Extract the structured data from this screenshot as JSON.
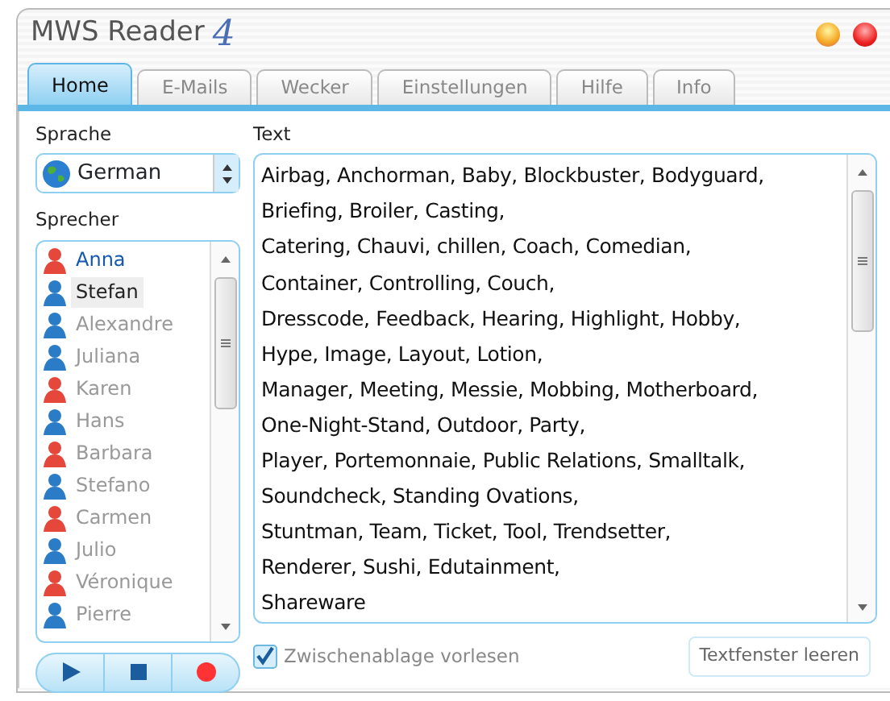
{
  "window": {
    "title": "MWS Reader",
    "version": "4"
  },
  "tabs": [
    {
      "label": "Home",
      "selected": true
    },
    {
      "label": "E-Mails",
      "selected": false
    },
    {
      "label": "Wecker",
      "selected": false
    },
    {
      "label": "Einstellungen",
      "selected": false
    },
    {
      "label": "Hilfe",
      "selected": false
    },
    {
      "label": "Info",
      "selected": false
    }
  ],
  "language": {
    "label": "Sprache",
    "value": "German"
  },
  "speakers": {
    "label": "Sprecher",
    "items": [
      {
        "name": "Anna",
        "kind": "female",
        "selected": false,
        "active": true
      },
      {
        "name": "Stefan",
        "kind": "male",
        "selected": true,
        "active": false
      },
      {
        "name": "Alexandre",
        "kind": "male",
        "selected": false,
        "active": false
      },
      {
        "name": "Juliana",
        "kind": "male",
        "selected": false,
        "active": false
      },
      {
        "name": "Karen",
        "kind": "female",
        "selected": false,
        "active": false
      },
      {
        "name": "Hans",
        "kind": "male",
        "selected": false,
        "active": false
      },
      {
        "name": "Barbara",
        "kind": "female",
        "selected": false,
        "active": false
      },
      {
        "name": "Stefano",
        "kind": "male",
        "selected": false,
        "active": false
      },
      {
        "name": "Carmen",
        "kind": "female",
        "selected": false,
        "active": false
      },
      {
        "name": "Julio",
        "kind": "male",
        "selected": false,
        "active": false
      },
      {
        "name": "Véronique",
        "kind": "female",
        "selected": false,
        "active": false
      },
      {
        "name": "Pierre",
        "kind": "male",
        "selected": false,
        "active": false
      }
    ]
  },
  "text": {
    "label": "Text",
    "lines": [
      "Airbag, Anchorman, Baby, Blockbuster, Bodyguard,",
      "Briefing, Broiler, Casting,",
      "Catering, Chauvi, chillen, Coach, Comedian,",
      "Container, Controlling, Couch,",
      "Dresscode, Feedback, Hearing, Highlight, Hobby,",
      "Hype, Image, Layout, Lotion,",
      "Manager, Meeting, Messie, Mobbing, Motherboard,",
      "One-Night-Stand, Outdoor, Party,",
      "Player, Portemonnaie, Public Relations, Smalltalk,",
      "Soundcheck, Standing Ovations,",
      "Stuntman, Team, Ticket, Tool, Trendsetter,",
      "Renderer, Sushi, Edutainment,",
      "Shareware"
    ]
  },
  "clipboard": {
    "label": "Zwischenablage vorlesen",
    "checked": true
  },
  "clear_button": "Textfenster leeren"
}
